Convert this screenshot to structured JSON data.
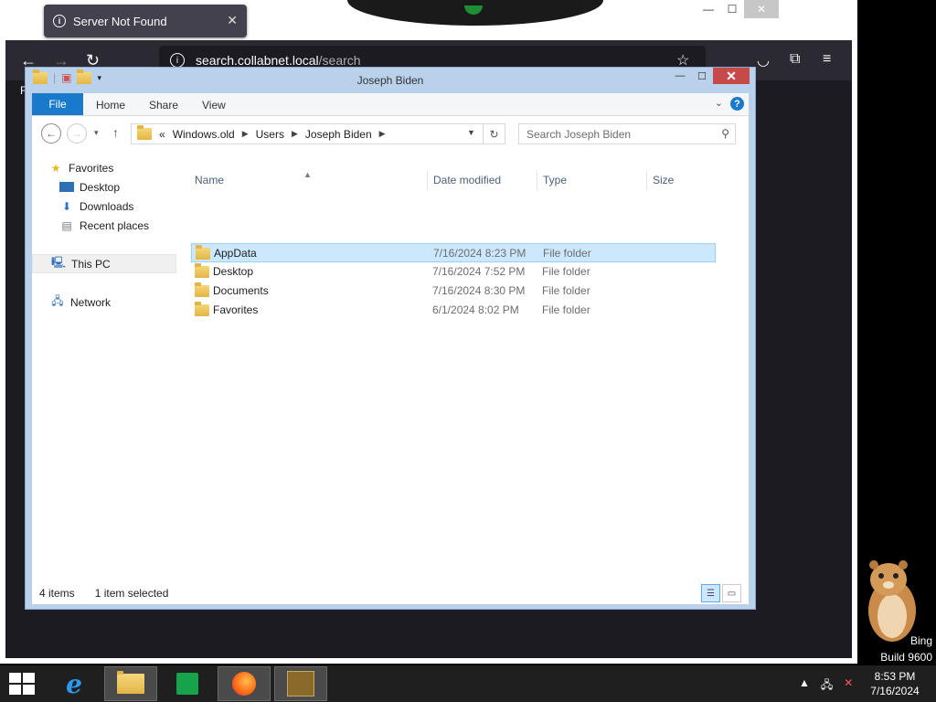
{
  "browser": {
    "toast_text": "Server Not Found",
    "url_host": "search.collabnet.local",
    "url_path": "/search",
    "side_text": "Fo"
  },
  "explorer": {
    "title": "Joseph Biden",
    "ribbon_tabs": [
      "File",
      "Home",
      "Share",
      "View"
    ],
    "breadcrumb": [
      "Windows.old",
      "Users",
      "Joseph Biden"
    ],
    "breadcrumb_prefix": "«",
    "search_placeholder": "Search Joseph Biden",
    "nav": {
      "favorites": "Favorites",
      "desktop": "Desktop",
      "downloads": "Downloads",
      "recent": "Recent places",
      "this_pc": "This PC",
      "network": "Network"
    },
    "columns": {
      "name": "Name",
      "date": "Date modified",
      "type": "Type",
      "size": "Size"
    },
    "rows": [
      {
        "name": "AppData",
        "date": "7/16/2024 8:23 PM",
        "type": "File folder",
        "selected": true
      },
      {
        "name": "Desktop",
        "date": "7/16/2024 7:52 PM",
        "type": "File folder",
        "selected": false
      },
      {
        "name": "Documents",
        "date": "7/16/2024 8:30 PM",
        "type": "File folder",
        "selected": false
      },
      {
        "name": "Favorites",
        "date": "6/1/2024 8:02 PM",
        "type": "File folder",
        "selected": false
      }
    ],
    "status": {
      "items": "4 items",
      "selected": "1 item selected"
    }
  },
  "desktop": {
    "watermark_line1": "Bing",
    "watermark_line2": "Build 9600"
  },
  "taskbar": {
    "time": "8:53 PM",
    "date": "7/16/2024",
    "apps": [
      "internet-explorer",
      "file-explorer",
      "store",
      "firefox",
      "game-box"
    ]
  },
  "colors": {
    "accent": "#1979ca",
    "selection": "#cce8ff",
    "close_red": "#c74a4a"
  }
}
